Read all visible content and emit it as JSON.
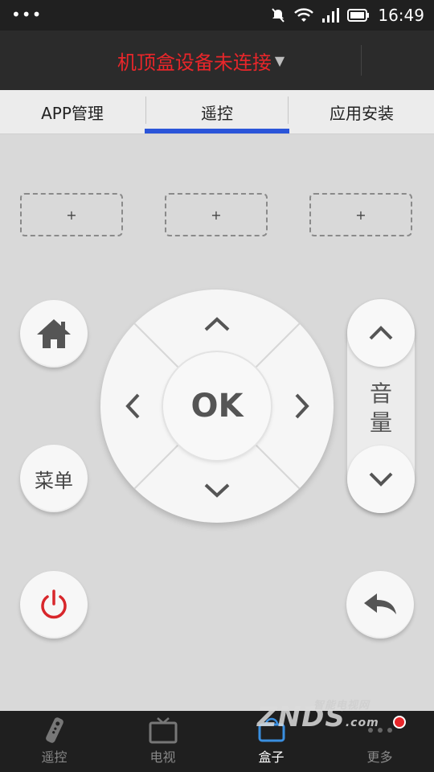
{
  "status_bar": {
    "dots": "•••",
    "time": "16:49"
  },
  "header": {
    "title": "机顶盒设备未连接",
    "caret": "▼"
  },
  "tabs": [
    {
      "label": "APP管理"
    },
    {
      "label": "遥控",
      "active": true
    },
    {
      "label": "应用安装"
    }
  ],
  "slots": [
    {
      "label": "+"
    },
    {
      "label": "+"
    },
    {
      "label": "+"
    }
  ],
  "remote": {
    "home_icon": "home-icon",
    "menu_label": "菜单",
    "power_icon": "power-icon",
    "back_icon": "back-arrow-icon",
    "ok_label": "OK",
    "volume_label_1": "音",
    "volume_label_2": "量"
  },
  "bottom_nav": [
    {
      "label": "遥控",
      "icon": "remote-icon"
    },
    {
      "label": "电视",
      "icon": "tv-icon"
    },
    {
      "label": "盒子",
      "icon": "box-icon",
      "active": true
    },
    {
      "label": "更多",
      "icon": "more-icon",
      "badge": true
    }
  ],
  "watermark": {
    "text": "ZNDS",
    "suffix": ".com",
    "top_text": "智能电视网"
  },
  "colors": {
    "accent_blue": "#2b55d9",
    "alert_red": "#e8262a"
  }
}
